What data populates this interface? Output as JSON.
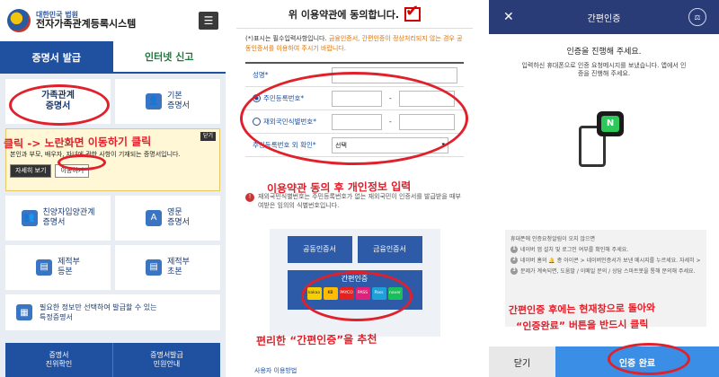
{
  "panel1": {
    "header": {
      "agency": "대한민국 법원",
      "title": "전자가족관계등록시스템",
      "menu_icon": "hamburger-icon"
    },
    "tabs": [
      "증명서 발급",
      "인터넷 신고"
    ],
    "cards": [
      {
        "label": "가족관계\n증명서",
        "icon": "family-doc-icon"
      },
      {
        "label": "기본\n증명서",
        "icon": "person-icon"
      },
      {
        "label": "친양자입양관계\n증명서",
        "icon": "group-icon"
      },
      {
        "label": "영문\n증명서",
        "icon": "english-doc-icon"
      },
      {
        "label": "제적부\n등본",
        "icon": "book-icon"
      },
      {
        "label": "제적부\n초본",
        "icon": "book-icon"
      }
    ],
    "popup": {
      "text": "본인과 부모, 배우자, 자녀에 관한 사항이 기재되는 증명서입니다.",
      "btn1": "자세히 보기",
      "btn2": "이동하기",
      "tag": "닫기"
    },
    "wide_card": "필요한 정보만 선택하여 발급할 수 있는\n특정증명서",
    "footer": [
      "증명서\n진위확인",
      "증명서발급\n민원안내"
    ],
    "annotation": "클릭 -> 노란화면 이동하기 클릭"
  },
  "panel2": {
    "top": "위 이용약관에 동의합니다.",
    "note_req": "(*)표시는 필수입력사항입니다.",
    "note_org": "금융인증서, 간편인증이 정상처리되지 않는 경우 공동인증서를 이용하여 주시기 바랍니다.",
    "fields": [
      "성명*",
      "주민등록번호*",
      "재외국민식별번호*",
      "주민등록번호 외 확인*"
    ],
    "select": "선택",
    "warn": "재외국민식별번호는 주민등록번호가 없는 재외국민이 인증서를 발급받을 때부여받은 임의의 식별번호입니다.",
    "cert_btns": [
      "공동인증서",
      "금융인증서"
    ],
    "easy": "간편인증",
    "logos": [
      "kakao",
      "KB",
      "PAYCO",
      "PASS",
      "Pass",
      "naver"
    ],
    "annotation_top": "이용약관 동의 후 개인정보 입력",
    "annotation_bottom": "편리한 “간편인증”을 추천",
    "bottom_text": "사용자 이용방법"
  },
  "panel3": {
    "header": "간편인증",
    "head_line": "인증을 진행해 주세요.",
    "sub_line": "입력하신 휴대폰으로 인증 요청메시지를 보냈습니다. 앱에서 인증을 진행해 주세요.",
    "help_title": "휴대폰에 인증요청알림이 오지 않으면",
    "help_steps": [
      "네이버 앱 설치 및 로그인 여부를 확인해 주세요.",
      "네이버 홈의 🔔 종 아이콘 > 네이버인증서가 보낸 메시지를 누르세요. 자세히 >",
      "문제가 계속되면, 도움말 / 이메일 문의 / 상담 스마트봇을 통해 문의해 주세요."
    ],
    "cancel": "닫기",
    "done": "인증 완료",
    "annotation": "간편인증 후에는 현재창으로 돌아와\n“인증완료” 버튼을 반드시 클릭",
    "badge": "N"
  }
}
